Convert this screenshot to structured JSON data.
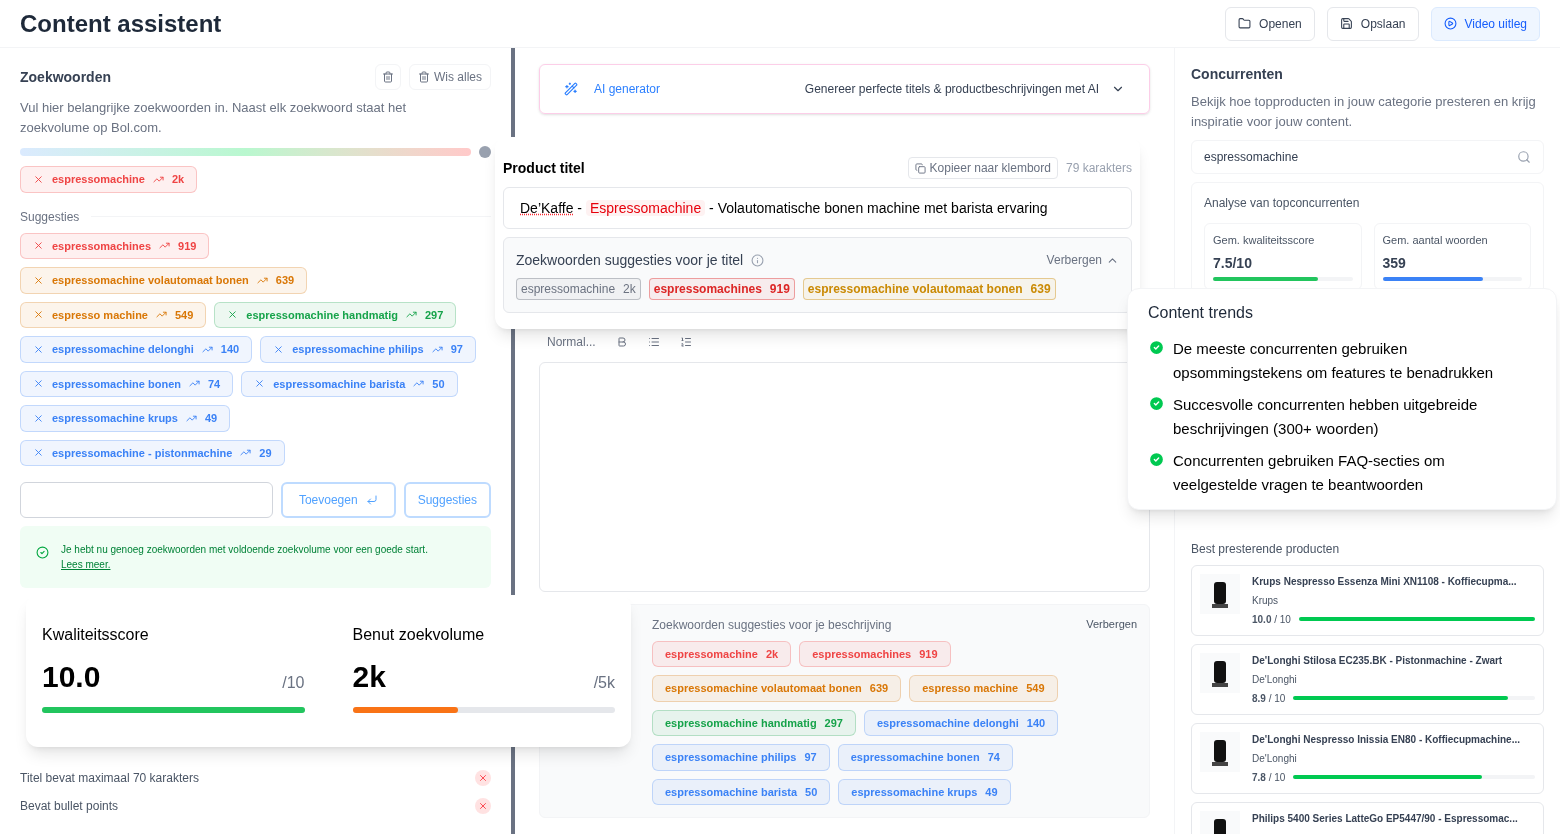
{
  "header": {
    "title": "Content assistent",
    "buttons": [
      {
        "kind": "plain",
        "label": "Openen"
      },
      {
        "kind": "plain",
        "label": "Opslaan"
      },
      {
        "kind": "accent",
        "label": "Video uitleg"
      }
    ]
  },
  "keywords": {
    "title": "Zoekwoorden",
    "clear_label": "Wis alles",
    "description": "Vul hier belangrijke zoekwoorden in. Naast elk zoekwoord staat het zoekvolume op Bol.com.",
    "selected": [
      {
        "label": "espressomachine",
        "volume": "2k",
        "color": "#ef4444"
      }
    ],
    "suggestions_title": "Suggesties",
    "suggestions": [
      {
        "label": "espressomachines",
        "volume": "919",
        "color": "#ef4444"
      },
      {
        "label": "espressomachine volautomaat bonen",
        "volume": "639",
        "color": "#d97706"
      },
      {
        "label": "espresso machine",
        "volume": "549",
        "color": "#d97706"
      },
      {
        "label": "espressomachine handmatig",
        "volume": "297",
        "color": "#16a34a"
      },
      {
        "label": "espressomachine delonghi",
        "volume": "140",
        "color": "#3b82f6"
      },
      {
        "label": "espressomachine philips",
        "volume": "97",
        "color": "#3b82f6"
      },
      {
        "label": "espressomachine bonen",
        "volume": "74",
        "color": "#3b82f6"
      },
      {
        "label": "espressomachine barista",
        "volume": "50",
        "color": "#3b82f6"
      },
      {
        "label": "espressomachine krups",
        "volume": "49",
        "color": "#3b82f6"
      },
      {
        "label": "espressomachine - pistonmachine",
        "volume": "29",
        "color": "#3b82f6"
      }
    ],
    "add_label": "Toevoegen",
    "suggest_label": "Suggesties",
    "notice": "Je hebt nu genoeg zoekwoorden met voldoende zoekvolume voor een goede start.",
    "notice_link": "Lees meer.",
    "checks": [
      {
        "label": "Titel bevat maximaal 70 karakters",
        "passed": false
      },
      {
        "label": "Bevat bullet points",
        "passed": false
      }
    ]
  },
  "ai_generator": {
    "label": "AI generator",
    "text": "Genereer perfecte titels & productbeschrijvingen met AI"
  },
  "editor": {
    "style": "Normal...",
    "suggestions_title": "Zoekwoorden suggesties voor je beschrijving",
    "toggle": "Verbergen",
    "chips": [
      {
        "label": "espressomachine",
        "volume": "2k",
        "color": "#ef4444"
      },
      {
        "label": "espressomachines",
        "volume": "919",
        "color": "#ef4444"
      },
      {
        "label": "espressomachine volautomaat bonen",
        "volume": "639",
        "color": "#d97706"
      },
      {
        "label": "espresso machine",
        "volume": "549",
        "color": "#d97706"
      },
      {
        "label": "espressomachine handmatig",
        "volume": "297",
        "color": "#16a34a"
      },
      {
        "label": "espressomachine delonghi",
        "volume": "140",
        "color": "#3b82f6"
      },
      {
        "label": "espressomachine philips",
        "volume": "97",
        "color": "#3b82f6"
      },
      {
        "label": "espressomachine bonen",
        "volume": "74",
        "color": "#3b82f6"
      },
      {
        "label": "espressomachine barista",
        "volume": "50",
        "color": "#3b82f6"
      },
      {
        "label": "espressomachine krups",
        "volume": "49",
        "color": "#3b82f6"
      }
    ]
  },
  "competitors": {
    "title": "Concurrenten",
    "description": "Bekijk hoe topproducten in jouw categorie presteren en krijg inspiratie voor jouw content.",
    "search": "espressomachine",
    "analysis_title": "Analyse van topconcurrenten",
    "stats": [
      {
        "label": "Gem. kwaliteitsscore",
        "value": "7.5/10",
        "level": 0.75,
        "color": "#22c55e"
      },
      {
        "label": "Gem. aantal woorden",
        "value": "359",
        "level": 0.72,
        "color": "#3b82f6"
      }
    ],
    "products_title": "Best presterende producten",
    "products": [
      {
        "name": "Krups Nespresso Essenza Mini XN1108 - Koffiecupma...",
        "brand": "Krups",
        "score": "10.0",
        "out_of": "/ 10",
        "level": 1.0
      },
      {
        "name": "De'Longhi Stilosa EC235.BK - Pistonmachine - Zwart",
        "brand": "De'Longhi",
        "score": "8.9",
        "out_of": "/ 10",
        "level": 0.89
      },
      {
        "name": "De'Longhi Nespresso Inissia EN80 - Koffiecupmachine...",
        "brand": "De'Longhi",
        "score": "7.8",
        "out_of": "/ 10",
        "level": 0.78
      },
      {
        "name": "Philips 5400 Series LatteGo EP5447/90 - Espressomac..."
      }
    ]
  },
  "title_card": {
    "title": "Product titel",
    "copy_label": "Kopieer naar klembord",
    "count": "79 karakters",
    "segments": [
      {
        "kind": "misspelled",
        "text": "De’Kaffe"
      },
      {
        "kind": "plain",
        "text": " - "
      },
      {
        "kind": "keyword",
        "text": "Espressomachine"
      },
      {
        "kind": "plain",
        "text": " - Volautomatische bonen machine met barista ervaring"
      }
    ],
    "suggestions_title": "Zoekwoorden suggesties voor je titel",
    "toggle": "Verbergen",
    "chips": [
      {
        "label": "espressomachine",
        "volume": "2k",
        "color": "#6b7280"
      },
      {
        "label": "espressomachines",
        "volume": "919",
        "color": "#dc2626"
      },
      {
        "label": "espressomachine volautomaat bonen",
        "volume": "639",
        "color": "#ca8a04"
      }
    ]
  },
  "trends_card": {
    "title": "Content trends",
    "items": [
      "De meeste concurrenten gebruiken opsommingstekens om features te benadrukken",
      "Succesvolle concurrenten hebben uitgebreide beschrijvingen (300+ woorden)",
      "Concurrenten gebruiken FAQ-secties om veelgestelde vragen te beantwoorden"
    ]
  },
  "score_card": {
    "metrics": [
      {
        "label": "Kwaliteitsscore",
        "value": "10.0",
        "max": "/10",
        "level": 1.0,
        "color": "#22c55e"
      },
      {
        "label": "Benut zoekvolume",
        "value": "2k",
        "max": "/5k",
        "level": 0.4,
        "color": "#f97316"
      }
    ]
  }
}
